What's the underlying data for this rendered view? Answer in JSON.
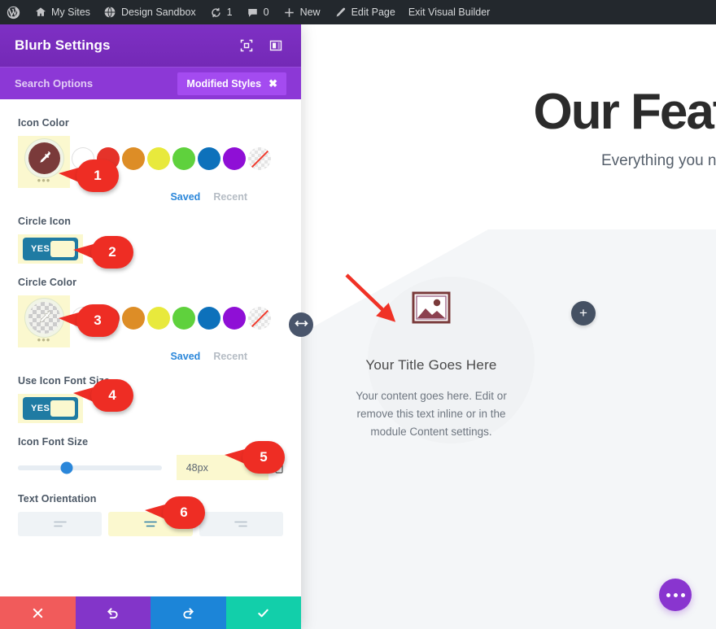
{
  "adminbar": {
    "items": [
      {
        "icon": "wordpress-icon",
        "label": ""
      },
      {
        "icon": "sites-icon",
        "label": "My Sites"
      },
      {
        "icon": "site-icon",
        "label": "Design Sandbox"
      },
      {
        "icon": "updates-icon",
        "label": "1"
      },
      {
        "icon": "comments-icon",
        "label": "0"
      },
      {
        "icon": "plus-icon",
        "label": "New"
      },
      {
        "icon": "pencil-icon",
        "label": "Edit Page"
      },
      {
        "icon": "",
        "label": "Exit Visual Builder"
      }
    ]
  },
  "settings": {
    "title": "Blurb Settings",
    "header_icons": [
      "expand-icon",
      "layout-icon"
    ],
    "search": {
      "placeholder": "Search Options",
      "value": ""
    },
    "modified_pill": {
      "label": "Modified Styles",
      "close": "✖"
    },
    "fields": {
      "icon_color": {
        "label": "Icon Color",
        "current": "#7a3a3a",
        "dots": "•••",
        "presets": [
          "#ffffff",
          "#e5332a",
          "#dd8d26",
          "#e8e93c",
          "#5fd13d",
          "#0d71bb",
          "#8f0fd6",
          "none"
        ],
        "saved_label": "Saved",
        "recent_label": "Recent"
      },
      "circle_icon": {
        "label": "Circle Icon",
        "value": "YES"
      },
      "circle_color": {
        "label": "Circle Color",
        "current": "transparent",
        "dots": "•••",
        "presets": [
          "#ffffff",
          "#e5332a",
          "#dd8d26",
          "#e8e93c",
          "#5fd13d",
          "#0d71bb",
          "#8f0fd6",
          "none"
        ],
        "saved_label": "Saved",
        "recent_label": "Recent"
      },
      "use_icon_font_size": {
        "label": "Use Icon Font Size",
        "value": "YES"
      },
      "icon_font_size": {
        "label": "Icon Font Size",
        "value": "48px",
        "slider_percent": 34,
        "unit_icon": "device-icon"
      },
      "text_orientation": {
        "label": "Text Orientation",
        "options": [
          "align-left-icon",
          "align-center-icon",
          "align-right-icon"
        ],
        "selected_index": 1
      }
    },
    "actions": [
      {
        "name": "cancel",
        "icon": "✖",
        "color": "#f15b5b"
      },
      {
        "name": "undo",
        "icon": "↺",
        "color": "#8335c9"
      },
      {
        "name": "redo",
        "icon": "↻",
        "color": "#1c85d8"
      },
      {
        "name": "save",
        "icon": "✔",
        "color": "#12cfaa"
      }
    ]
  },
  "preview": {
    "hero_title": "Our Feat",
    "hero_subtitle": "Everything you ne",
    "blurb": {
      "icon": "image-placeholder-icon",
      "title": "Your Title Goes Here",
      "body": "Your content goes here. Edit or remove this text inline or in the module Content settings."
    },
    "add_button": "+",
    "fab": "•••",
    "resize_handle": "resize-horizontal-icon"
  },
  "callouts": [
    {
      "number": "1"
    },
    {
      "number": "2"
    },
    {
      "number": "3"
    },
    {
      "number": "4"
    },
    {
      "number": "5"
    },
    {
      "number": "6"
    }
  ]
}
